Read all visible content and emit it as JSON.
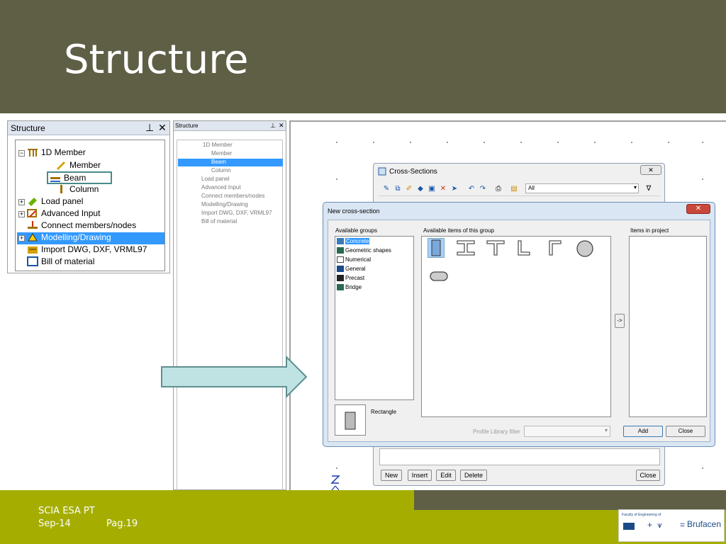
{
  "slide": {
    "title": "Structure"
  },
  "footer": {
    "line1": "SCIA ESA PT",
    "date": "Sep-14",
    "page": "Pag.19",
    "logo_caption": "Faculty of Engineering of",
    "logo_brand": "Brufacen"
  },
  "panel1": {
    "title": "Structure",
    "items": [
      {
        "label": "1D Member"
      },
      {
        "label": "Member"
      },
      {
        "label": "Beam"
      },
      {
        "label": "Column"
      },
      {
        "label": "Load panel"
      },
      {
        "label": "Advanced Input"
      },
      {
        "label": "Connect members/nodes"
      },
      {
        "label": "Modelling/Drawing"
      },
      {
        "label": "Import DWG, DXF, VRML97"
      },
      {
        "label": "Bill of material"
      }
    ]
  },
  "panel2": {
    "title": "Structure",
    "items": [
      {
        "label": "1D Member"
      },
      {
        "label": "Member"
      },
      {
        "label": "Beam"
      },
      {
        "label": "Column"
      },
      {
        "label": "Load panel"
      },
      {
        "label": "Advanced Input"
      },
      {
        "label": "Connect members/nodes"
      },
      {
        "label": "Modelling/Drawing"
      },
      {
        "label": "Import DWG, DXF, VRML97"
      },
      {
        "label": "Bill of material"
      }
    ]
  },
  "cross_sections": {
    "title": "Cross-Sections",
    "filter_value": "All",
    "buttons": {
      "new": "New",
      "insert": "Insert",
      "edit": "Edit",
      "delete": "Delete",
      "close": "Close"
    }
  },
  "new_cross_section": {
    "title": "New cross-section",
    "groups_label": "Available groups",
    "items_label": "Available items of this group",
    "project_label": "Items in project",
    "groups": [
      {
        "label": "Concrete"
      },
      {
        "label": "Geometric shapes"
      },
      {
        "label": "Numerical"
      },
      {
        "label": "General"
      },
      {
        "label": "Precast"
      },
      {
        "label": "Bridge"
      }
    ],
    "preview_label": "Rectangle",
    "arrow_button": "->",
    "library_filter_label": "Profile Library filter",
    "add_button": "Add",
    "close_button": "Close"
  },
  "colors": {
    "title_bar": "#5f5f46",
    "footer": "#a5ae00",
    "selection": "#3399ff",
    "arrow": "#bfe3e3"
  }
}
